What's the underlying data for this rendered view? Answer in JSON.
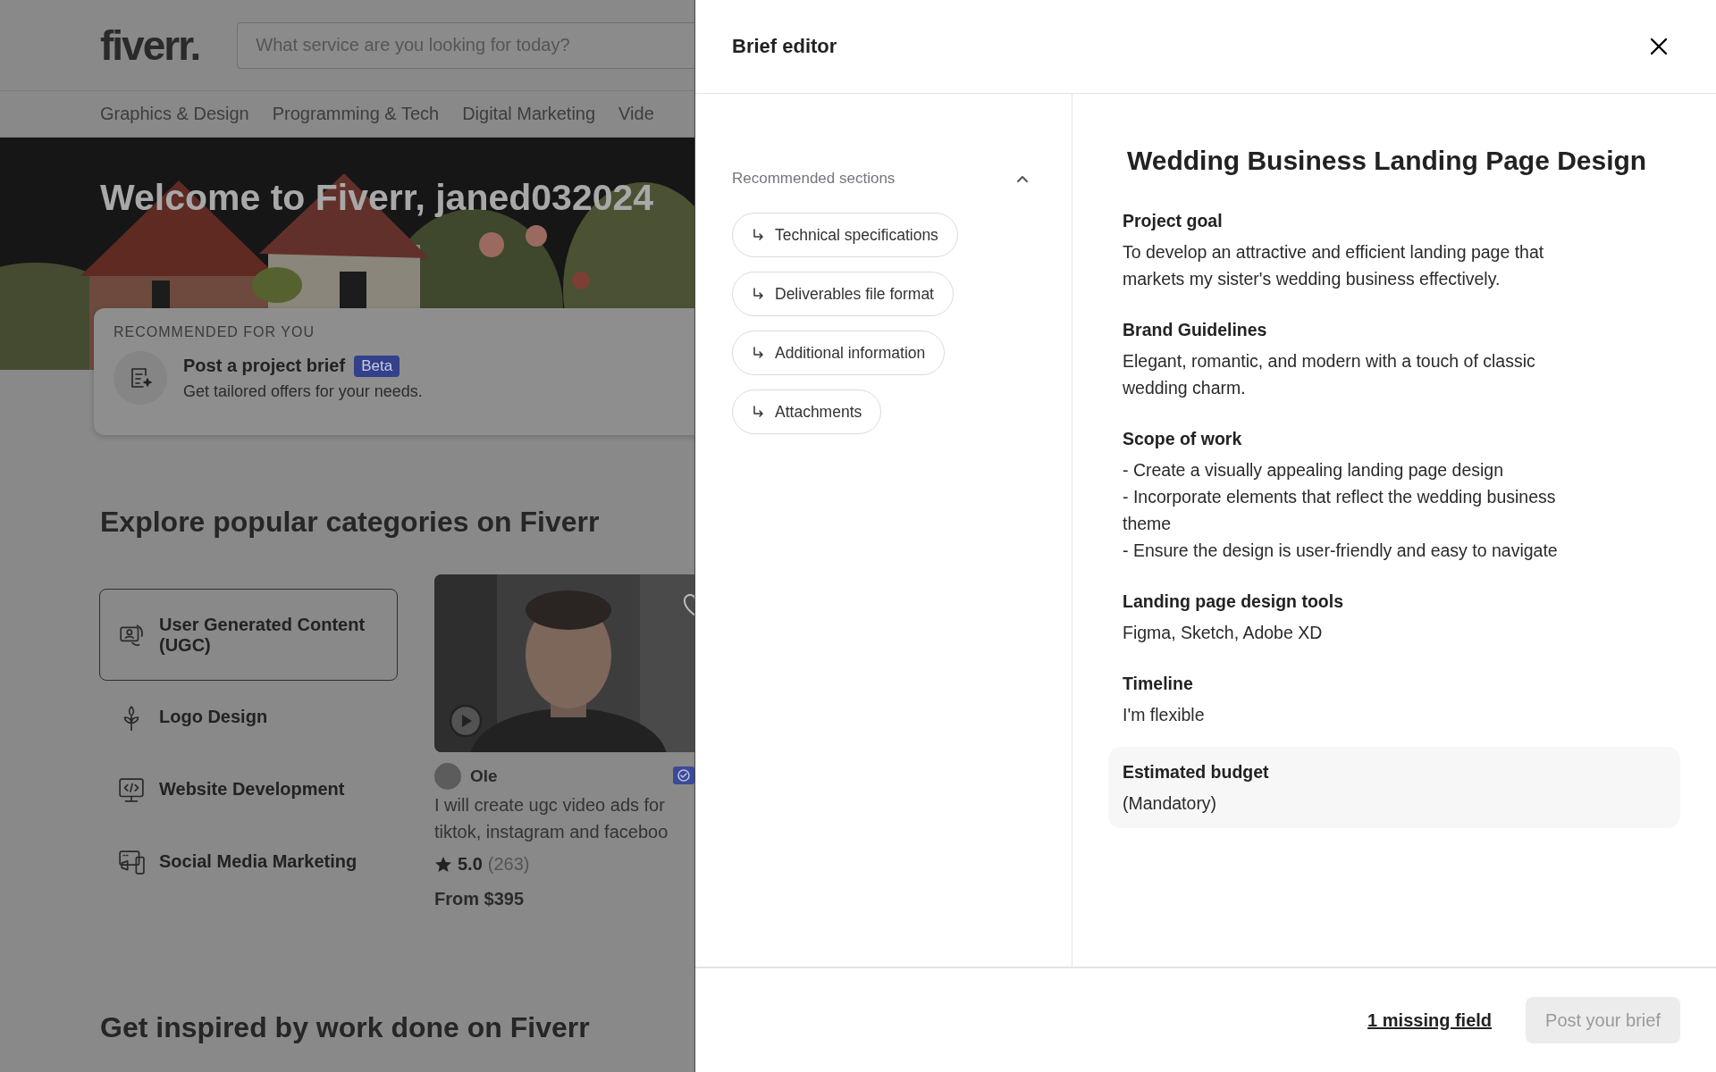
{
  "header": {
    "logo": "fiverr.",
    "search": {
      "placeholder": "What service are you looking for today?"
    }
  },
  "category_nav": [
    "Graphics & Design",
    "Programming & Tech",
    "Digital Marketing",
    "Vide"
  ],
  "hero": {
    "title": "Welcome to Fiverr, janed032024"
  },
  "recommended": {
    "heading": "RECOMMENDED FOR YOU",
    "title": "Post a project brief",
    "badge": "Beta",
    "subtitle": "Get tailored offers for your needs."
  },
  "categories": {
    "heading": "Explore popular categories on Fiverr",
    "items": [
      {
        "label": "User Generated Content (UGC)",
        "selected": true
      },
      {
        "label": "Logo Design",
        "selected": false
      },
      {
        "label": "Website Development",
        "selected": false
      },
      {
        "label": "Social Media Marketing",
        "selected": false
      }
    ]
  },
  "gig": {
    "seller": "Ole",
    "title_lines": [
      "I will create ugc video ads for",
      "tiktok, instagram and faceboo"
    ],
    "rating": "5.0",
    "reviews": "(263)",
    "price": "From $395"
  },
  "inspired_heading": "Get inspired by work done on Fiverr",
  "brief_editor": {
    "title": "Brief editor",
    "sections_heading": "Recommended sections",
    "sections_expanded": true,
    "section_chips": [
      "Technical specifications",
      "Deliverables file format",
      "Additional information",
      "Attachments"
    ],
    "brief_title": "Wedding Business Landing Page Design",
    "fields": [
      {
        "label": "Project goal",
        "value": "To develop an attractive and efficient landing page that\nmarkets my sister's wedding business effectively."
      },
      {
        "label": "Brand Guidelines",
        "value": "Elegant, romantic, and modern with a touch of classic\nwedding charm."
      },
      {
        "label": "Scope of work",
        "value": "- Create a visually appealing landing page design\n- Incorporate elements that reflect the wedding business\ntheme\n- Ensure the design is user-friendly and easy to navigate"
      },
      {
        "label": "Landing page design tools",
        "value": "Figma, Sketch, Adobe XD"
      },
      {
        "label": "Timeline",
        "value": "I'm flexible"
      }
    ],
    "budget_field": {
      "label": "Estimated budget",
      "value": "(Mandatory)"
    },
    "missing_link": "1 missing field",
    "post_button": {
      "label": "Post your brief",
      "disabled": true
    }
  }
}
